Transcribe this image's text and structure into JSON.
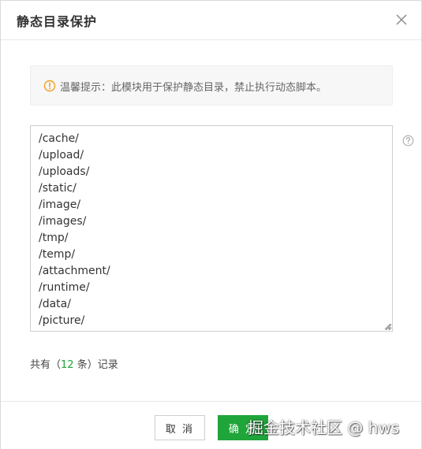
{
  "dialog": {
    "title": "静态目录保护",
    "close_icon": "close-icon"
  },
  "notice": {
    "icon": "warning-circle-icon",
    "text": "温馨提示：此模块用于保护静态目录，禁止执行动态脚本。"
  },
  "directories": {
    "content": "/cache/\n/upload/\n/uploads/\n/static/\n/image/\n/images/\n/tmp/\n/temp/\n/attachment/\n/runtime/\n/data/\n/picture/",
    "help_icon": "question-circle-icon"
  },
  "count": {
    "prefix": "共有（",
    "number": "12",
    "suffix": " 条）记录"
  },
  "footer": {
    "cancel_label": "取 消",
    "confirm_label": "确 定"
  },
  "watermark": "掘金技术社区 @ hws",
  "colors": {
    "accent": "#20a53a",
    "warning": "#f0a020"
  }
}
